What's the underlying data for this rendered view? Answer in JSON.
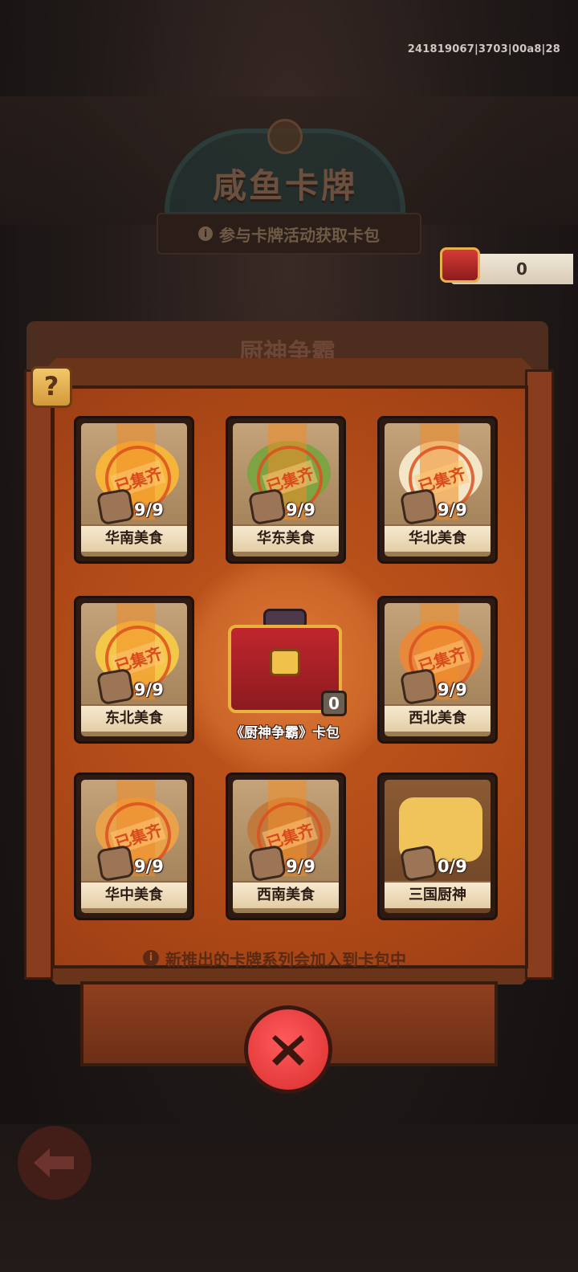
{
  "header": {
    "version": "241819067|3703|00a8|28",
    "title": "咸鱼卡牌",
    "subtitle": "参与卡牌活动获取卡包",
    "pack_counter": "0"
  },
  "panel": {
    "title": "厨神争霸",
    "help_label": "?",
    "footnote": "新推出的卡牌系列会加入到卡包中",
    "cards": [
      {
        "label": "华南美食",
        "count": "9/9",
        "stamp": "已集齐",
        "food_color": "#f4b53a"
      },
      {
        "label": "华东美食",
        "count": "9/9",
        "stamp": "已集齐",
        "food_color": "#7ea342"
      },
      {
        "label": "华北美食",
        "count": "9/9",
        "stamp": "已集齐",
        "food_color": "#f2e6c6"
      },
      {
        "label": "东北美食",
        "count": "9/9",
        "stamp": "已集齐",
        "food_color": "#f3c848"
      },
      {
        "label": "西北美食",
        "count": "9/9",
        "stamp": "已集齐",
        "food_color": "#e7893a"
      },
      {
        "label": "华中美食",
        "count": "9/9",
        "stamp": "已集齐",
        "food_color": "#e8a24a"
      },
      {
        "label": "西南美食",
        "count": "9/9",
        "stamp": "已集齐",
        "food_color": "#c07a3e"
      },
      {
        "label": "三国厨神",
        "count": "0/9",
        "stamp": "",
        "food_color": "#f0c45a"
      }
    ],
    "pack": {
      "label": "《厨神争霸》卡包",
      "count": "0"
    }
  },
  "icons": {
    "close": "close-icon",
    "back": "back-arrow-icon",
    "info": "info-icon",
    "help": "question-icon"
  },
  "colors": {
    "accent_orange": "#c3581f",
    "close_red": "#e43b3b",
    "gold": "#e7b33e"
  }
}
